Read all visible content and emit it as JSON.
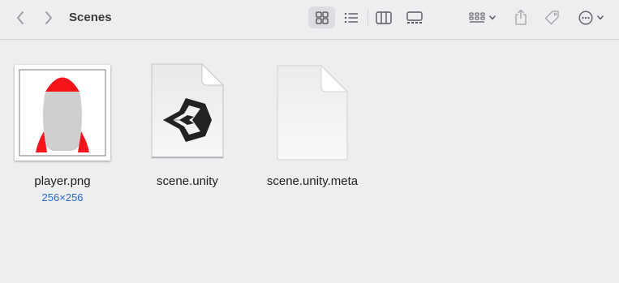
{
  "toolbar": {
    "title": "Scenes",
    "icons": {
      "back": "chevron-left-icon",
      "forward": "chevron-right-icon",
      "icon_view": "grid-icon",
      "list_view": "list-icon",
      "column_view": "columns-icon",
      "gallery_view": "gallery-icon",
      "group": "group-by-icon",
      "share": "share-icon",
      "tags": "tag-icon",
      "more": "ellipsis-circle-icon"
    }
  },
  "files": [
    {
      "name": "player.png",
      "detail": "256×256",
      "kind": "image-thumbnail"
    },
    {
      "name": "scene.unity",
      "detail": "",
      "kind": "unity-document-icon"
    },
    {
      "name": "scene.unity.meta",
      "detail": "",
      "kind": "blank-document-icon"
    }
  ],
  "colors": {
    "background": "#eceef0",
    "accent": "#2a6bd1",
    "rocket_red": "#f5141a",
    "rocket_body": "#cfcfcf"
  }
}
